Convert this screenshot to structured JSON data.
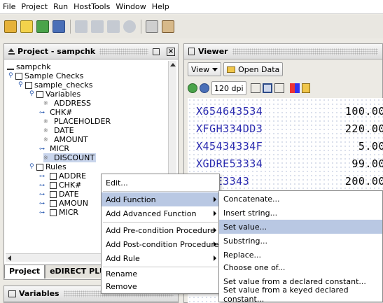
{
  "menubar": [
    "File",
    "Project",
    "Run",
    "HostTools",
    "Window",
    "Help"
  ],
  "project_panel": {
    "title": "Project - sampchk",
    "tree": {
      "root": "sampchk",
      "sample_checks": "Sample Checks",
      "sample_checks_file": "sample_checks",
      "variables": "Variables",
      "variable_items": [
        "ADDRESS",
        "CHK#",
        "PLACEHOLDER",
        "DATE",
        "AMOUNT",
        "MICR",
        "DISCOUNT"
      ],
      "rules": "Rules",
      "rule_items": [
        "ADDRE",
        "CHK#",
        "DATE",
        "AMOUN",
        "MICR"
      ]
    },
    "tabs": [
      "Project",
      "eDIRECT PLU"
    ]
  },
  "variables_panel": {
    "title": "Variables"
  },
  "viewer": {
    "title": "Viewer",
    "view_label": "View",
    "open_data_label": "Open Data",
    "dpi": "120 dpi",
    "rows": [
      {
        "id": "X654643534",
        "amount": "100.00"
      },
      {
        "id": "XFGH334DD3",
        "amount": "220.00"
      },
      {
        "id": "X45434334F",
        "amount": "5.00"
      },
      {
        "id": "XGDRE53334",
        "amount": "99.00"
      },
      {
        "id": "XGFE3343",
        "amount": "200.00"
      }
    ]
  },
  "context_menu": [
    {
      "label": "Edit...",
      "submenu": false
    },
    {
      "label": "Add Function",
      "submenu": true,
      "highlighted": true
    },
    {
      "label": "Add Advanced Function",
      "submenu": true
    },
    {
      "label": "Add Pre-condition Procedure",
      "submenu": true
    },
    {
      "label": "Add Post-condition Procedure",
      "submenu": true
    },
    {
      "label": "Add Rule",
      "submenu": true
    },
    {
      "label": "Rename",
      "submenu": false
    },
    {
      "label": "Remove",
      "submenu": false
    }
  ],
  "submenu": [
    {
      "label": "Concatenate..."
    },
    {
      "label": "Insert string..."
    },
    {
      "label": "Set value...",
      "highlighted": true
    },
    {
      "label": "Substring..."
    },
    {
      "label": "Replace..."
    },
    {
      "label": "Choose one of..."
    },
    {
      "label": "Set value from a declared constant..."
    },
    {
      "label": "Set value from a keyed declared constant..."
    }
  ],
  "colors": {
    "highlight": "#b9c8e3",
    "data_text": "#2b2bb0"
  }
}
